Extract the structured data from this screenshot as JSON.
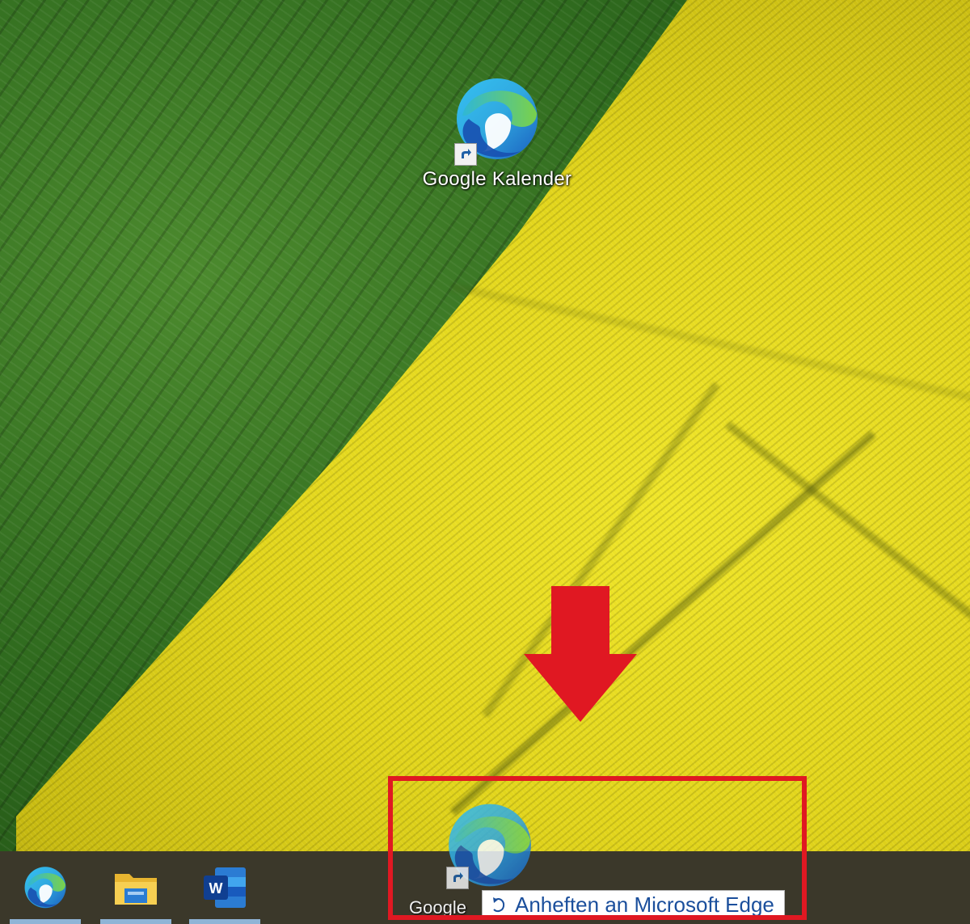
{
  "desktop": {
    "icons": [
      {
        "label": "Google Kalender",
        "icon": "edge-icon",
        "shortcut": true
      }
    ]
  },
  "annotation": {
    "arrow_color": "#e01822",
    "highlight_color": "#e01822"
  },
  "taskbar": {
    "pinned": [
      {
        "name": "Microsoft Edge",
        "icon": "edge-icon"
      },
      {
        "name": "File Explorer",
        "icon": "folder-icon"
      },
      {
        "name": "Word",
        "icon": "word-icon"
      }
    ]
  },
  "drag": {
    "ghost_label": "Google",
    "tooltip": "Anheften an Microsoft Edge"
  }
}
